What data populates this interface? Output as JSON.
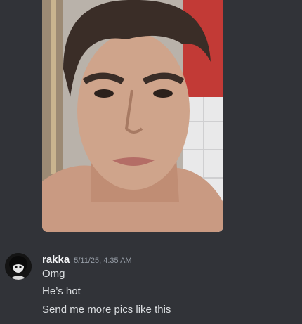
{
  "attachment": {
    "type": "image",
    "subject": "selfie photo of a man"
  },
  "message": {
    "author": "rakka",
    "timestamp": "5/11/25, 4:35 AM",
    "lines": [
      "Omg",
      "He’s hot",
      "Send me more pics like this"
    ]
  },
  "colors": {
    "background": "#313338",
    "username": "#f2f3f5",
    "timestamp": "#949ba4",
    "text": "#dbdee1"
  }
}
